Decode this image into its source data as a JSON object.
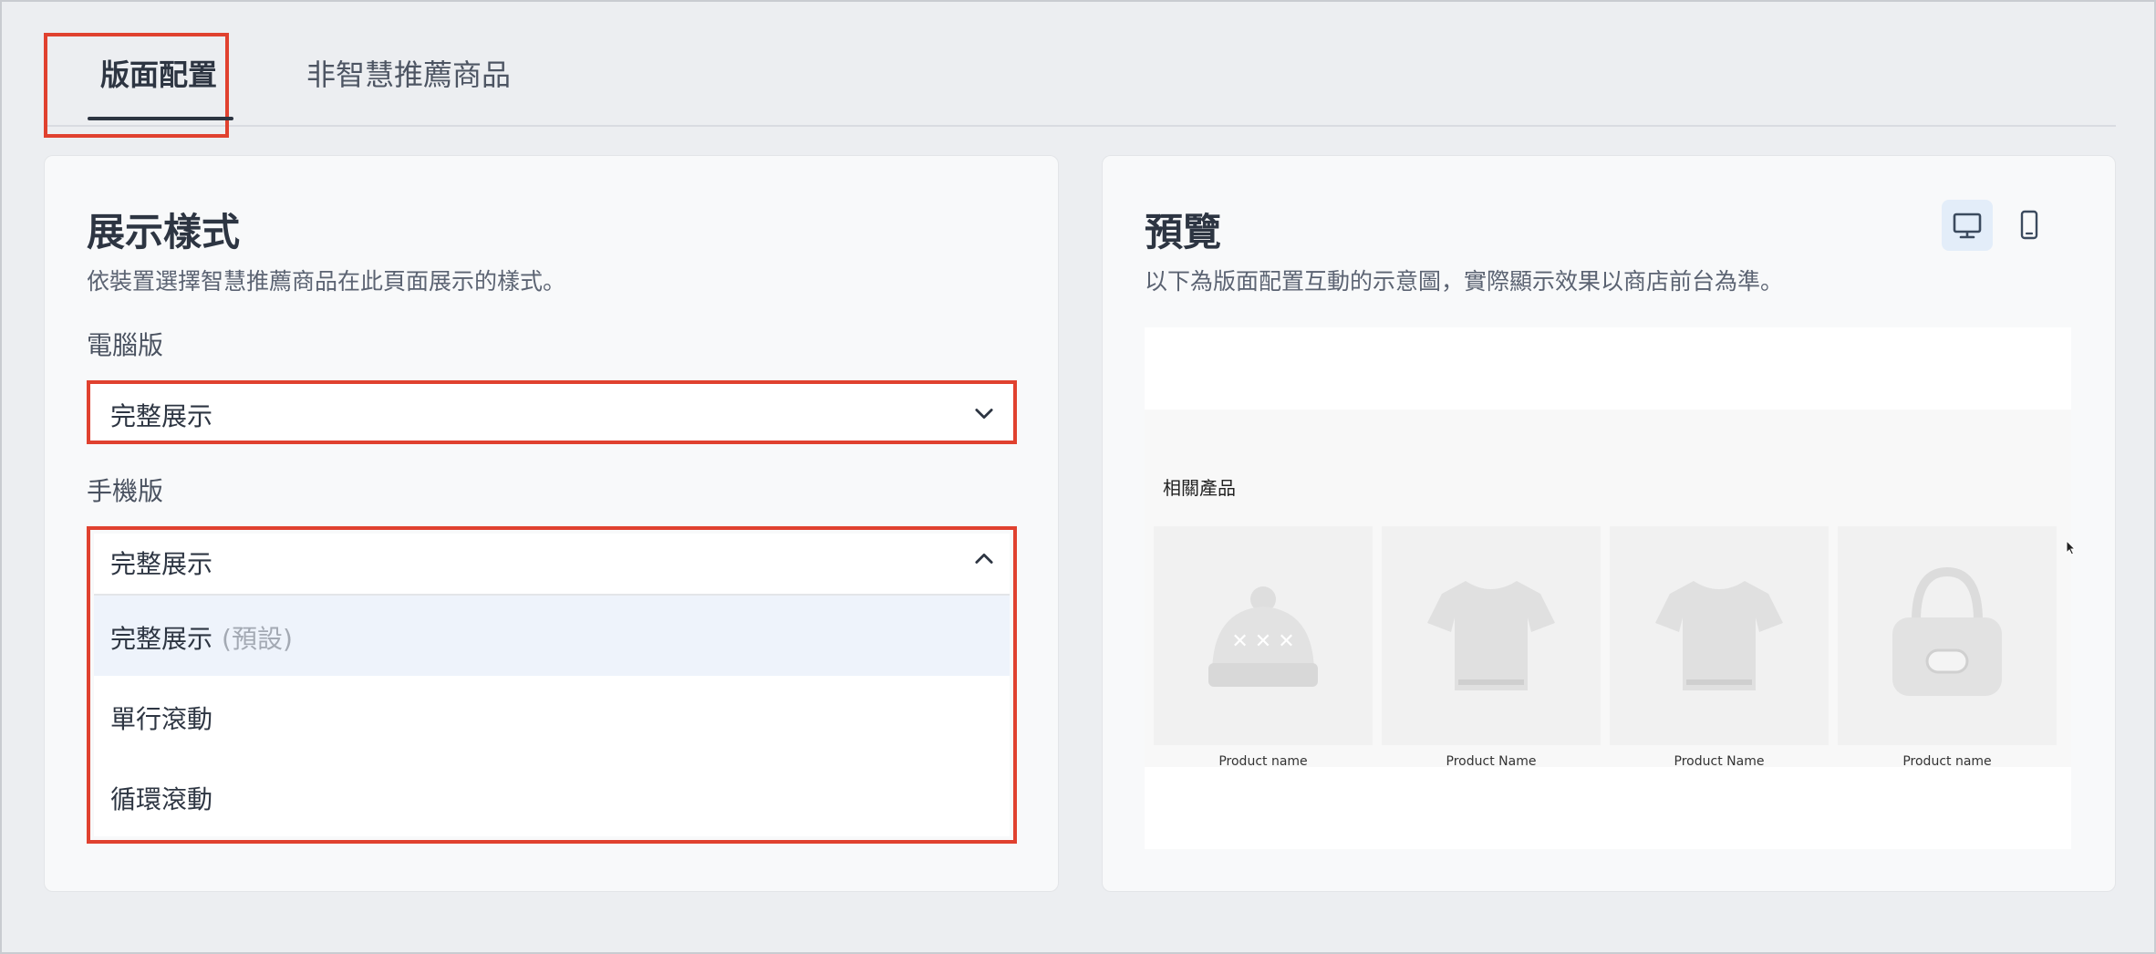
{
  "tabs": {
    "layout": "版面配置",
    "non_smart": "非智慧推薦商品"
  },
  "display_style": {
    "title": "展示樣式",
    "subtitle": "依裝置選擇智慧推薦商品在此頁面展示的樣式。",
    "desktop_label": "電腦版",
    "desktop_value": "完整展示",
    "mobile_label": "手機版",
    "mobile_value": "完整展示",
    "options": [
      {
        "label": "完整展示",
        "hint": "(預設)"
      },
      {
        "label": "單行滾動",
        "hint": ""
      },
      {
        "label": "循環滾動",
        "hint": ""
      }
    ]
  },
  "preview": {
    "title": "預覽",
    "subtitle": "以下為版面配置互動的示意圖，實際顯示效果以商店前台為準。",
    "section_title": "相關產品",
    "products": [
      {
        "name": "Product name",
        "icon": "beanie-icon"
      },
      {
        "name": "Product Name",
        "icon": "tshirt-icon"
      },
      {
        "name": "Product Name",
        "icon": "tshirt-icon"
      },
      {
        "name": "Product name",
        "icon": "handbag-icon"
      }
    ]
  },
  "colors": {
    "highlight": "#e0412f",
    "selected_option_bg": "#eef3fb",
    "active_device_bg": "#e3edf9"
  }
}
